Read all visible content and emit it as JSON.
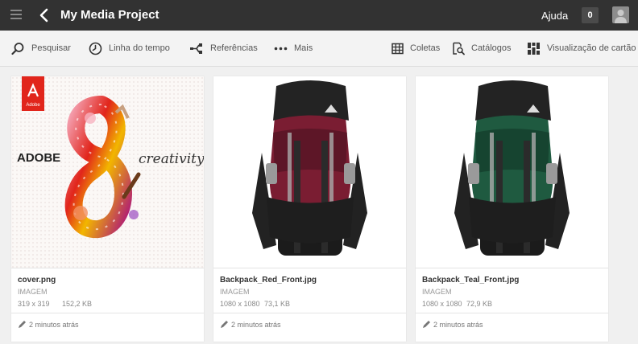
{
  "header": {
    "title": "My Media Project",
    "help_label": "Ajuda",
    "notification_count": "0"
  },
  "toolbar": {
    "search": "Pesquisar",
    "timeline": "Linha do tempo",
    "references": "Referências",
    "more": "Mais",
    "collections": "Coletas",
    "catalogs": "Catálogos",
    "card_view": "Visualização de cartão"
  },
  "cover": {
    "adobe_text": "ADOBE",
    "script_text": "creativity",
    "logo_text": "Adobe",
    "badge_color": "#e1251b"
  },
  "cards": [
    {
      "name": "cover.png",
      "type": "IMAGEM",
      "dimensions": "319 x 319",
      "size": "152,2 KB",
      "modified": "2 minutos atrás"
    },
    {
      "name": "Backpack_Red_Front.jpg",
      "type": "IMAGEM",
      "dimensions": "1080 x 1080",
      "size": "73,1 KB",
      "modified": "2 minutos atrás",
      "color": "#7a1d32"
    },
    {
      "name": "Backpack_Teal_Front.jpg",
      "type": "IMAGEM",
      "dimensions": "1080 x 1080",
      "size": "72,9 KB",
      "modified": "2 minutos atrás",
      "color": "#1f5a40"
    }
  ]
}
